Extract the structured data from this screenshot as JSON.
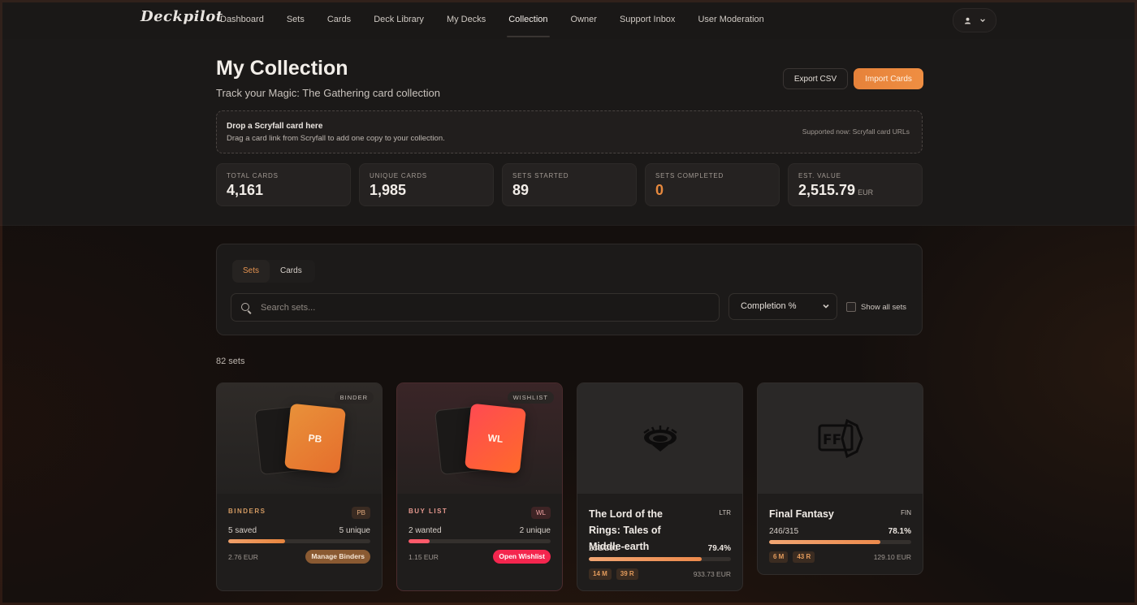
{
  "app": {
    "logo": "Deckpilot"
  },
  "nav": {
    "items": [
      {
        "label": "Dashboard"
      },
      {
        "label": "Sets"
      },
      {
        "label": "Cards"
      },
      {
        "label": "Deck Library"
      },
      {
        "label": "My Decks"
      },
      {
        "label": "Collection",
        "active": true
      },
      {
        "label": "Owner"
      },
      {
        "label": "Support Inbox"
      },
      {
        "label": "User Moderation"
      }
    ],
    "user_icon": "user-icon",
    "user_chevron": "chevron-down-icon"
  },
  "header": {
    "title": "My Collection",
    "subtitle": "Track your Magic: The Gathering card collection",
    "export_label": "Export CSV",
    "import_label": "Import Cards"
  },
  "dropzone": {
    "title": "Drop a Scryfall card here",
    "subtitle": "Drag a card link from Scryfall to add one copy to your collection.",
    "supported": "Supported now: Scryfall card URLs"
  },
  "stats": [
    {
      "label": "TOTAL CARDS",
      "value": "4,161"
    },
    {
      "label": "UNIQUE CARDS",
      "value": "1,985"
    },
    {
      "label": "SETS STARTED",
      "value": "89"
    },
    {
      "label": "SETS COMPLETED",
      "value": "0"
    },
    {
      "label": "EST. VALUE",
      "value": "2,515.79",
      "unit": "EUR"
    }
  ],
  "filters": {
    "tabs": [
      {
        "label": "Sets",
        "active": true
      },
      {
        "label": "Cards"
      }
    ],
    "search_placeholder": "Search sets...",
    "sort_value": "Completion %",
    "show_all_label": "Show all sets",
    "show_all_checked": false
  },
  "results": {
    "count_label": "82 sets"
  },
  "cards": {
    "binder": {
      "tag": "BINDER",
      "badge": "PB",
      "category": "BINDERS",
      "code": "PB",
      "left": "5 saved",
      "right": "5 unique",
      "progress": 0.4,
      "value": "2.76 EUR",
      "action": "Manage Binders"
    },
    "wishlist": {
      "tag": "WISHLIST",
      "badge": "WL",
      "category": "BUY LIST",
      "code": "WL",
      "left": "2 wanted",
      "right": "2 unique",
      "progress": 0.15,
      "value": "1.15 EUR",
      "action": "Open Wishlist"
    },
    "ltr": {
      "title": "The Lord of the Rings: Tales of Middle-earth",
      "code": "LTR",
      "owned": "231/291",
      "percent": "79.4%",
      "progress": 0.794,
      "mythic": "14 M",
      "rare": "39 R",
      "value": "933.73 EUR",
      "icon": "ltr-set-icon"
    },
    "fin": {
      "title": "Final Fantasy",
      "code": "FIN",
      "owned": "246/315",
      "percent": "78.1%",
      "progress": 0.781,
      "mythic": "6 M",
      "rare": "43 R",
      "value": "129.10 EUR",
      "icon": "fin-set-icon"
    }
  },
  "colors": {
    "accent": "#e8853e",
    "wishlist": "#f4264e",
    "background": "#140f0d"
  }
}
